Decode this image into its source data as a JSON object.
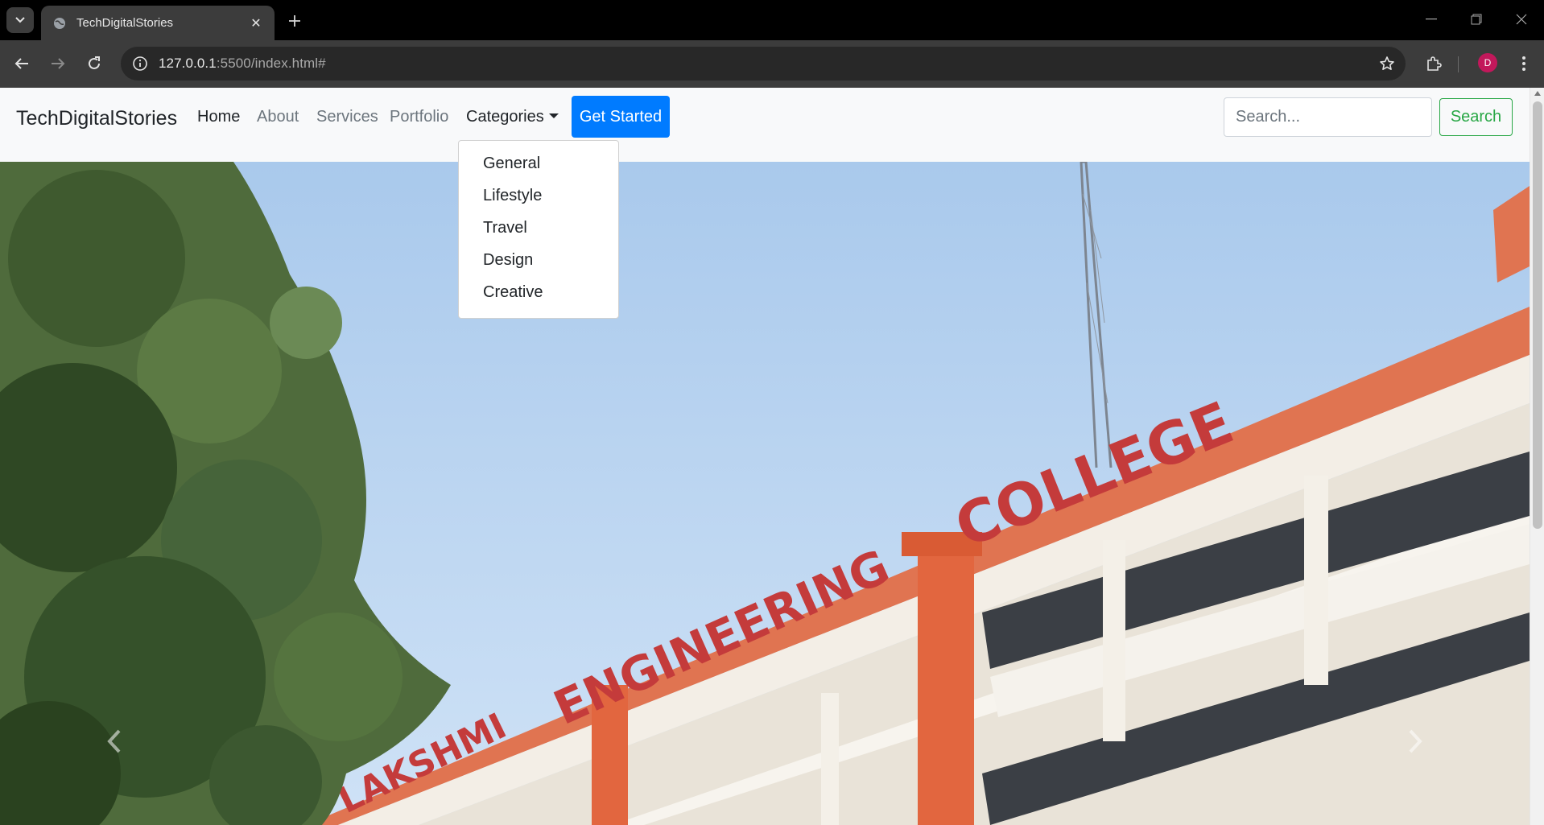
{
  "browser": {
    "tab_title": "TechDigitalStories",
    "url_host": "127.0.0.1",
    "url_rest": ":5500/index.html#",
    "profile_initial": "D"
  },
  "navbar": {
    "brand": "TechDigitalStories",
    "links": [
      {
        "label": "Home",
        "active": true
      },
      {
        "label": "About",
        "active": false
      },
      {
        "label": "Services",
        "active": false
      },
      {
        "label": "Portfolio",
        "active": false
      }
    ],
    "categories_label": "Categories",
    "cta_label": "Get Started",
    "search_placeholder": "Search...",
    "search_button": "Search"
  },
  "dropdown": {
    "items": [
      "General",
      "Lifestyle",
      "Travel",
      "Design",
      "Creative"
    ]
  },
  "carousel": {
    "sign_word_1": "COLLEGE",
    "sign_word_2": "ENGINEERING",
    "sign_word_3": "LAKSHMI"
  },
  "colors": {
    "primary": "#007bff",
    "success": "#28a745",
    "navbar_bg": "#f8f9fa"
  }
}
